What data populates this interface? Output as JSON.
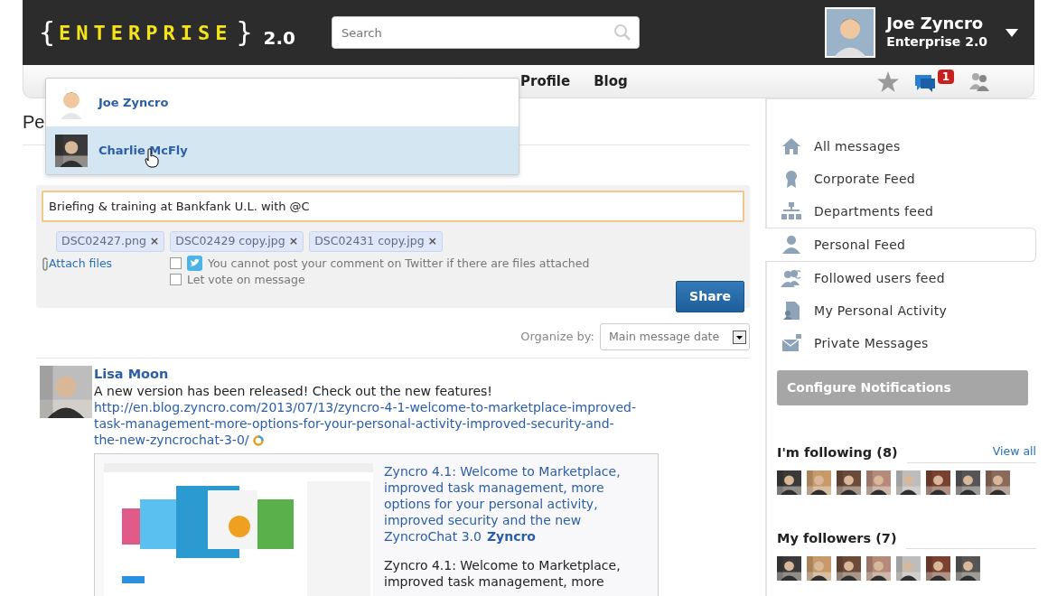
{
  "header": {
    "logo_open": "{",
    "logo_text": "ENTERPRISE",
    "logo_close": "}",
    "logo_version": "2.0",
    "search": {
      "placeholder": "Search"
    },
    "user": {
      "name": "Joe Zyncro",
      "subtitle": "Enterprise 2.0"
    }
  },
  "nav": {
    "items": [
      "Profile",
      "Blog"
    ],
    "notification_count": "1"
  },
  "mention_dropdown": [
    {
      "name": "Joe Zyncro",
      "selected": false
    },
    {
      "name": "Charlie McFly",
      "selected": true
    }
  ],
  "page_title": "Pe",
  "composer": {
    "value": "Briefing & training at Bankfank U.L. with @C",
    "attachments": [
      {
        "name": "DSC02427.png",
        "remove": "×"
      },
      {
        "name": "DSC02429 copy.jpg",
        "remove": "×"
      },
      {
        "name": "DSC02431 copy.jpg",
        "remove": "×"
      }
    ],
    "attach_label": "Attach files",
    "options": [
      {
        "kind": "twitter",
        "label": "You cannot post your comment on Twitter if there are files attached",
        "checked": false
      },
      {
        "kind": "plain",
        "label": "Let vote on message",
        "checked": false
      }
    ],
    "share": "Share"
  },
  "organize": {
    "label": "Organize by:",
    "value": "Main message date"
  },
  "post": {
    "author": "Lisa Moon",
    "text": "A new version has been released! Check out the new features!",
    "link": "http://en.blog.zyncro.com/2013/07/13/zyncro-4-1-welcome-to-marketplace-improved-task-management-more-options-for-your-personal-activity-improved-security-and-the-new-zyncrochat-3-0/",
    "preview": {
      "title": "Zyncro 4.1: Welcome to Marketplace, improved task management, more options for your personal activity, improved security and the new ZyncroChat 3.0",
      "source": "Zyncro",
      "description": "Zyncro 4.1: Welcome to Marketplace, improved task management, more"
    }
  },
  "sidebar": {
    "feeds": [
      {
        "label": "All messages",
        "selected": false
      },
      {
        "label": "Corporate Feed",
        "selected": false
      },
      {
        "label": "Departments feed",
        "selected": false
      },
      {
        "label": "Personal Feed",
        "selected": true
      },
      {
        "label": "Followed users feed",
        "selected": false
      },
      {
        "label": "My Personal Activity",
        "selected": false
      },
      {
        "label": "Private Messages",
        "selected": false
      }
    ],
    "configure": "Configure Notifications",
    "following": {
      "title": "I'm following (8)",
      "view_all": "View all"
    },
    "followers": {
      "title": "My followers (7)"
    }
  }
}
